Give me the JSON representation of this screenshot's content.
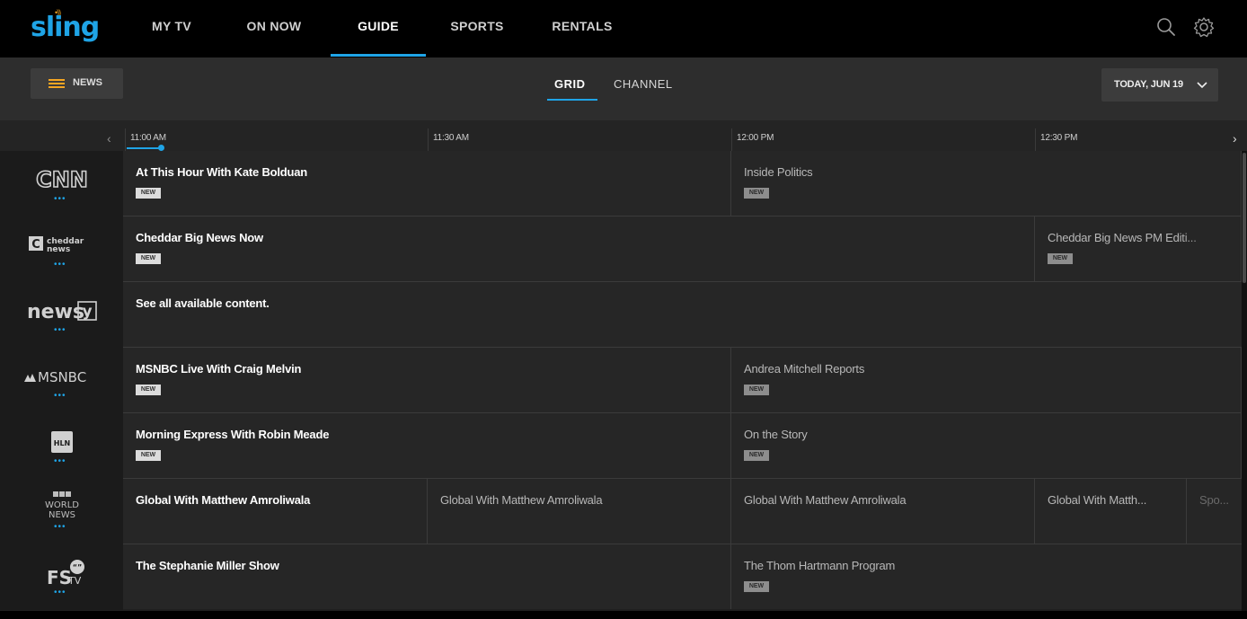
{
  "brand": {
    "name": "sling",
    "accent": "#1fa4e6",
    "signal_color": "#f5a623"
  },
  "nav": {
    "items": [
      {
        "label": "MY TV"
      },
      {
        "label": "ON NOW"
      },
      {
        "label": "GUIDE",
        "active": true
      },
      {
        "label": "SPORTS"
      },
      {
        "label": "RENTALS"
      }
    ],
    "icons": [
      "search-icon",
      "settings-gear-icon"
    ]
  },
  "subheader": {
    "filter_label": "NEWS",
    "filter_icon": "grid-list-icon",
    "view_tabs": [
      {
        "label": "GRID",
        "active": true
      },
      {
        "label": "CHANNEL"
      }
    ],
    "date_label": "TODAY, JUN 19",
    "date_icon": "chevron-down-icon"
  },
  "timeline": {
    "slots": [
      "11:00 AM",
      "11:30 AM",
      "12:00 PM",
      "12:30 PM"
    ],
    "prev_icon": "chevron-left-icon",
    "next_icon": "chevron-right-icon"
  },
  "new_badge": "NEW",
  "channels": [
    {
      "name": "CNN",
      "programs": [
        {
          "title": "At This Hour With Kate Bolduan",
          "new": true,
          "current": true
        },
        {
          "title": "Inside Politics",
          "new": true
        }
      ]
    },
    {
      "name": "cheddar news",
      "programs": [
        {
          "title": "Cheddar Big News Now",
          "new": true,
          "current": true
        },
        {
          "title": "Cheddar Big News PM Editi...",
          "new": true
        }
      ]
    },
    {
      "name": "newsy",
      "programs": [
        {
          "title": "See all available content.",
          "new": false,
          "current": true
        }
      ]
    },
    {
      "name": "MSNBC",
      "programs": [
        {
          "title": "MSNBC Live With Craig Melvin",
          "new": true,
          "current": true
        },
        {
          "title": "Andrea Mitchell Reports",
          "new": true
        }
      ]
    },
    {
      "name": "HLN",
      "programs": [
        {
          "title": "Morning Express With Robin Meade",
          "new": true,
          "current": true
        },
        {
          "title": "On the Story",
          "new": true
        }
      ]
    },
    {
      "name": "BBC WORLD NEWS",
      "programs": [
        {
          "title": "Global With Matthew Amroliwala",
          "current": true
        },
        {
          "title": "Global With Matthew Amroliwala"
        },
        {
          "title": "Global With Matthew Amroliwala"
        },
        {
          "title": "Global With Matth..."
        },
        {
          "title": "Spo..."
        }
      ]
    },
    {
      "name": "FSTV",
      "programs": [
        {
          "title": "The Stephanie Miller Show",
          "new": false,
          "current": true
        },
        {
          "title": "The Thom Hartmann Program",
          "new": true
        }
      ]
    }
  ]
}
